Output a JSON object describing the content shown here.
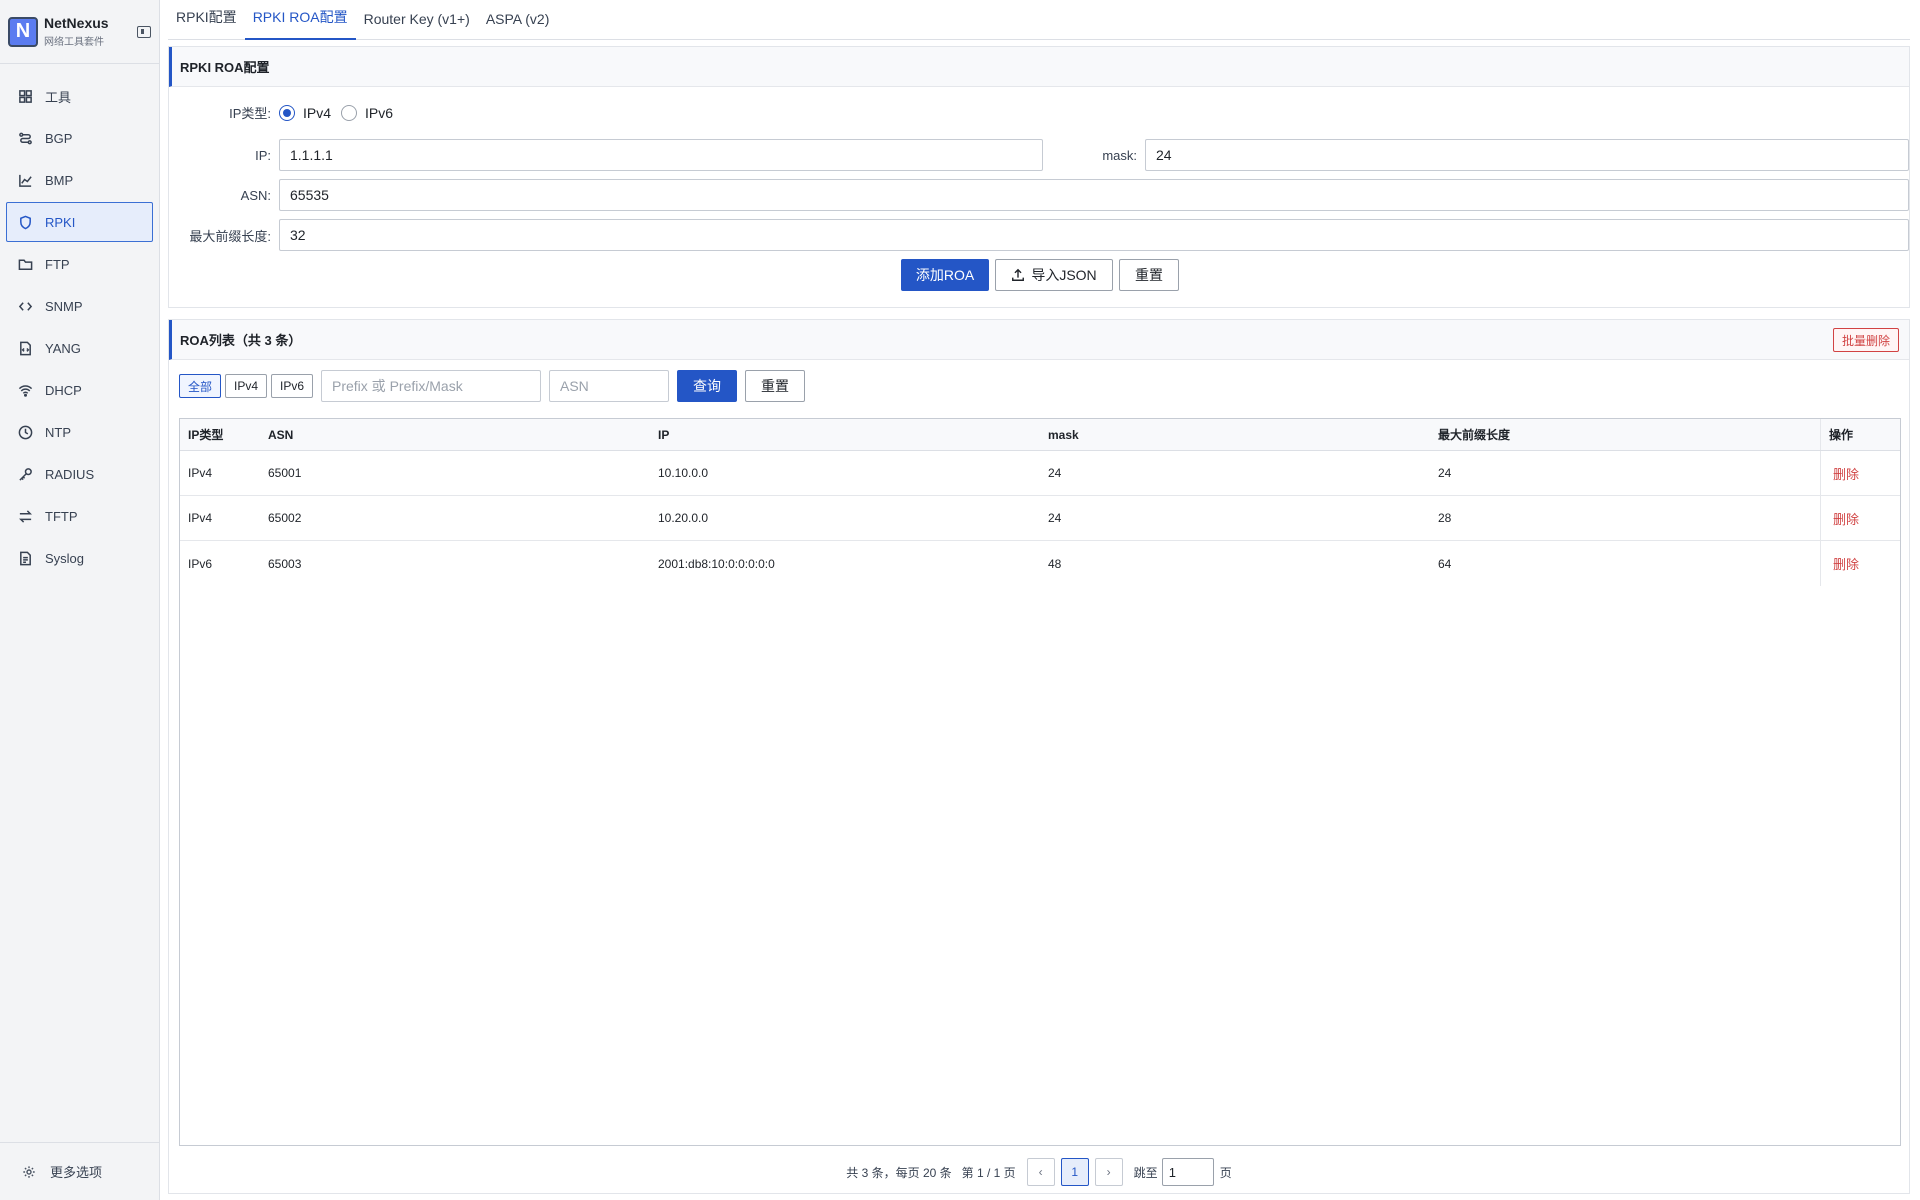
{
  "brand": {
    "name": "NetNexus",
    "subtitle": "网络工具套件",
    "logo_letter": "N",
    "accent": "#2456c6"
  },
  "sidebar": {
    "items": [
      {
        "label": "工具",
        "icon": "grid-icon"
      },
      {
        "label": "BGP",
        "icon": "route-icon"
      },
      {
        "label": "BMP",
        "icon": "chart-icon"
      },
      {
        "label": "RPKI",
        "icon": "shield-icon",
        "active": true
      },
      {
        "label": "FTP",
        "icon": "folder-icon"
      },
      {
        "label": "SNMP",
        "icon": "code-icon"
      },
      {
        "label": "YANG",
        "icon": "file-code-icon"
      },
      {
        "label": "DHCP",
        "icon": "wifi-icon"
      },
      {
        "label": "NTP",
        "icon": "clock-icon"
      },
      {
        "label": "RADIUS",
        "icon": "key-icon"
      },
      {
        "label": "TFTP",
        "icon": "transfer-icon"
      },
      {
        "label": "Syslog",
        "icon": "document-icon"
      }
    ],
    "footer": "更多选项"
  },
  "tabs": [
    "RPKI配置",
    "RPKI ROA配置",
    "Router Key (v1+)",
    "ASPA (v2)"
  ],
  "roa_form": {
    "title": "RPKI ROA配置",
    "ip_type_label": "IP类型:",
    "ip_type_options": [
      "IPv4",
      "IPv6"
    ],
    "ip_type_selected": "IPv4",
    "ip_label": "IP:",
    "ip_value": "1.1.1.1",
    "mask_label": "mask:",
    "mask_value": "24",
    "asn_label": "ASN:",
    "asn_value": "65535",
    "max_len_label": "最大前缀长度:",
    "max_len_value": "32",
    "add_button": "添加ROA",
    "import_button": "导入JSON",
    "reset_button": "重置"
  },
  "roa_list": {
    "title": "ROA列表（共 3 条）",
    "batch_delete": "批量删除",
    "filters": [
      "全部",
      "IPv4",
      "IPv6"
    ],
    "filter_active": "全部",
    "prefix_placeholder": "Prefix 或 Prefix/Mask",
    "asn_placeholder": "ASN",
    "query_button": "查询",
    "reset_button": "重置",
    "columns": [
      "IP类型",
      "ASN",
      "IP",
      "mask",
      "最大前缀长度",
      "操作"
    ],
    "rows": [
      {
        "type": "IPv4",
        "asn": "65001",
        "ip": "10.10.0.0",
        "mask": "24",
        "max_len": "24",
        "action": "删除"
      },
      {
        "type": "IPv4",
        "asn": "65002",
        "ip": "10.20.0.0",
        "mask": "24",
        "max_len": "28",
        "action": "删除"
      },
      {
        "type": "IPv6",
        "asn": "65003",
        "ip": "2001:db8:10:0:0:0:0:0",
        "mask": "48",
        "max_len": "64",
        "action": "删除"
      }
    ],
    "pager": {
      "summary": "共 3 条，每页 20 条",
      "page_info": "第 1 / 1 页",
      "prev": "‹",
      "current": "1",
      "next": "›",
      "jump_label": "跳至",
      "jump_value": "1",
      "jump_suffix": "页"
    }
  }
}
